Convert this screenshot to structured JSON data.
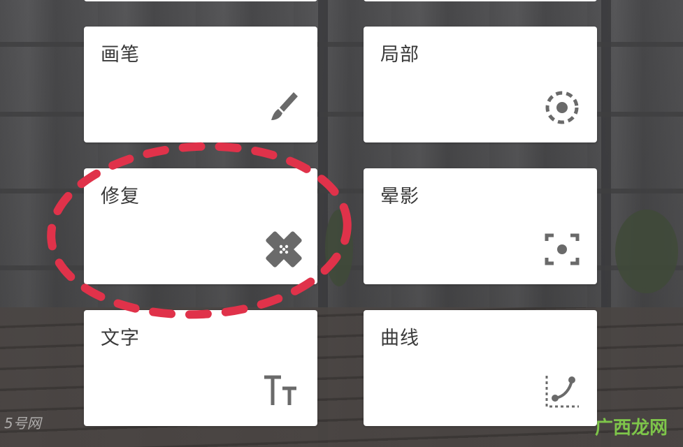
{
  "tools": [
    {
      "id": "brush",
      "label": "画笔",
      "icon": "brush-icon"
    },
    {
      "id": "selective",
      "label": "局部",
      "icon": "selective-icon"
    },
    {
      "id": "healing",
      "label": "修复",
      "icon": "bandage-icon"
    },
    {
      "id": "vignette",
      "label": "晕影",
      "icon": "vignette-icon"
    },
    {
      "id": "text",
      "label": "文字",
      "icon": "text-icon"
    },
    {
      "id": "curves",
      "label": "曲线",
      "icon": "curves-icon"
    }
  ],
  "icon_color": "#6a6a6a",
  "annotation_color": "#e0324a",
  "watermarks": {
    "left": "5号网",
    "right": "广西龙网"
  }
}
